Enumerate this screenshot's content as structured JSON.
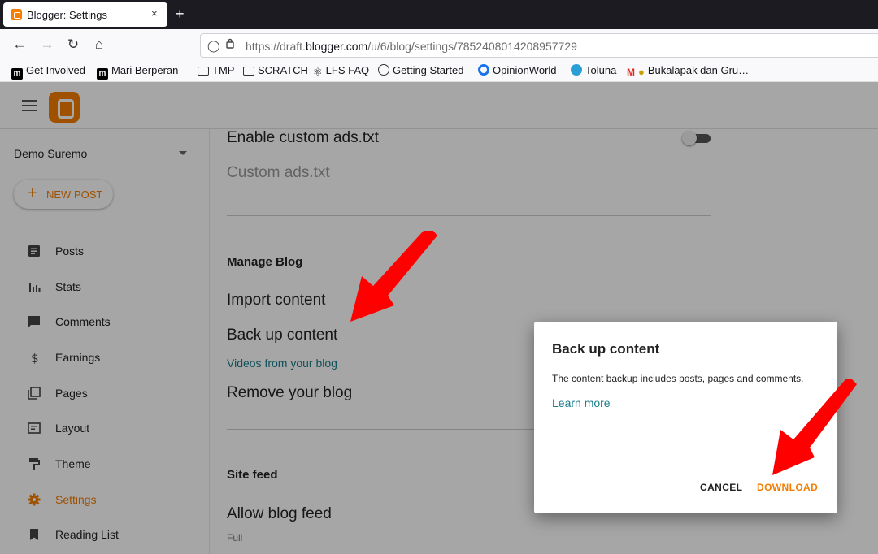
{
  "browser": {
    "tab_title": "Blogger: Settings",
    "tab_close": "×",
    "new_tab": "+",
    "url_prefix": "https://draft.",
    "url_host": "blogger.com",
    "url_path": "/u/6/blog/settings/7852408014208957729",
    "bookmarks": [
      {
        "label": "Get Involved",
        "icon": "m"
      },
      {
        "label": "Mari Berperan",
        "icon": "m"
      },
      {
        "label": "TMP",
        "icon": "folder"
      },
      {
        "label": "SCRATCH",
        "icon": "folder"
      },
      {
        "label": "LFS FAQ",
        "icon": "lfs"
      },
      {
        "label": "Getting Started",
        "icon": "globe"
      },
      {
        "label": "OpinionWorld",
        "icon": "op"
      },
      {
        "label": "Toluna",
        "icon": "tol"
      },
      {
        "label": "Bukalapak dan Gru…",
        "icon": "gmail-bag"
      }
    ]
  },
  "sidebar": {
    "blog_name": "Demo Suremo",
    "new_post": "NEW POST",
    "items": [
      {
        "label": "Posts",
        "icon": "posts-icon"
      },
      {
        "label": "Stats",
        "icon": "stats-icon"
      },
      {
        "label": "Comments",
        "icon": "comments-icon"
      },
      {
        "label": "Earnings",
        "icon": "earnings-icon"
      },
      {
        "label": "Pages",
        "icon": "pages-icon"
      },
      {
        "label": "Layout",
        "icon": "layout-icon"
      },
      {
        "label": "Theme",
        "icon": "theme-icon"
      },
      {
        "label": "Settings",
        "icon": "settings-icon",
        "active": true
      },
      {
        "label": "Reading List",
        "icon": "reading-list-icon"
      }
    ]
  },
  "content": {
    "enable_ads": "Enable custom ads.txt",
    "custom_ads": "Custom ads.txt",
    "manage_blog": "Manage Blog",
    "import_content": "Import content",
    "backup_content": "Back up content",
    "videos": "Videos from your blog",
    "remove_blog": "Remove your blog",
    "site_feed": "Site feed",
    "allow_feed": "Allow blog feed",
    "allow_feed_value": "Full"
  },
  "dialog": {
    "title": "Back up content",
    "body": "The content backup includes posts, pages and comments.",
    "learn_more": "Learn more",
    "cancel": "CANCEL",
    "download": "DOWNLOAD"
  },
  "colors": {
    "accent": "#f57d00",
    "link": "#1a7d8a",
    "annotation": "#ff0000"
  }
}
